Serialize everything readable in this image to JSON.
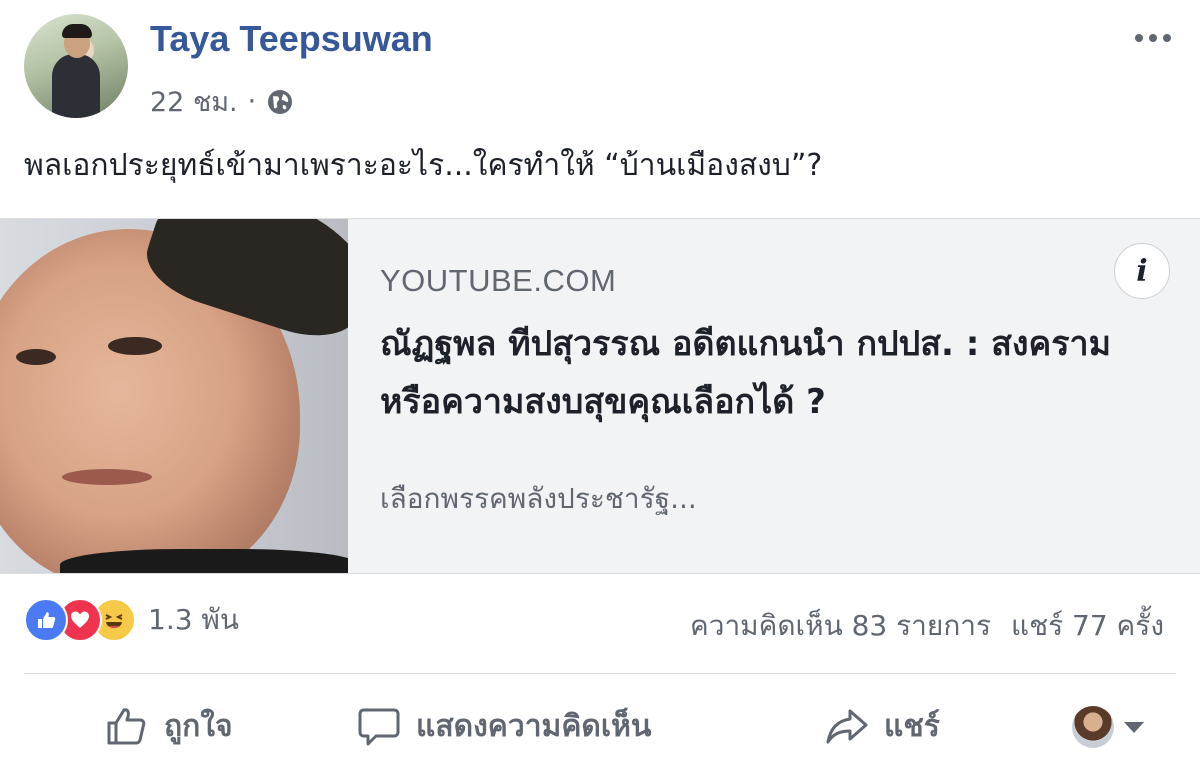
{
  "post": {
    "author": "Taya Teepsuwan",
    "time": "22 ชม.",
    "separator": "·",
    "audience_icon": "globe-icon",
    "text": "พลเอกประยุทธ์เข้ามาเพราะอะไร...ใครทำให้ “บ้านเมืองสงบ”?"
  },
  "link_preview": {
    "source": "YOUTUBE.COM",
    "title": "ณัฏฐพล ทีปสุวรรณ อดีตแกนนำ กปปส. : สงครามหรือความสงบสุขคุณเลือกได้ ?",
    "description": "เลือกพรรคพลังประชารัฐ...",
    "info_label": "i"
  },
  "stats": {
    "reactions": [
      "like-icon",
      "love-icon",
      "haha-icon"
    ],
    "reaction_count": "1.3 พัน",
    "comments": "ความคิดเห็น 83 รายการ",
    "shares": "แชร์ 77 ครั้ง"
  },
  "actions": {
    "like": "ถูกใจ",
    "comment": "แสดงความคิดเห็น",
    "share": "แชร์"
  },
  "colors": {
    "author": "#365899",
    "secondary_text": "#606770",
    "preview_bg": "#f2f3f5",
    "like_blue": "#4a7bf5",
    "love_red": "#f0334f",
    "haha_yellow": "#f7c948"
  }
}
